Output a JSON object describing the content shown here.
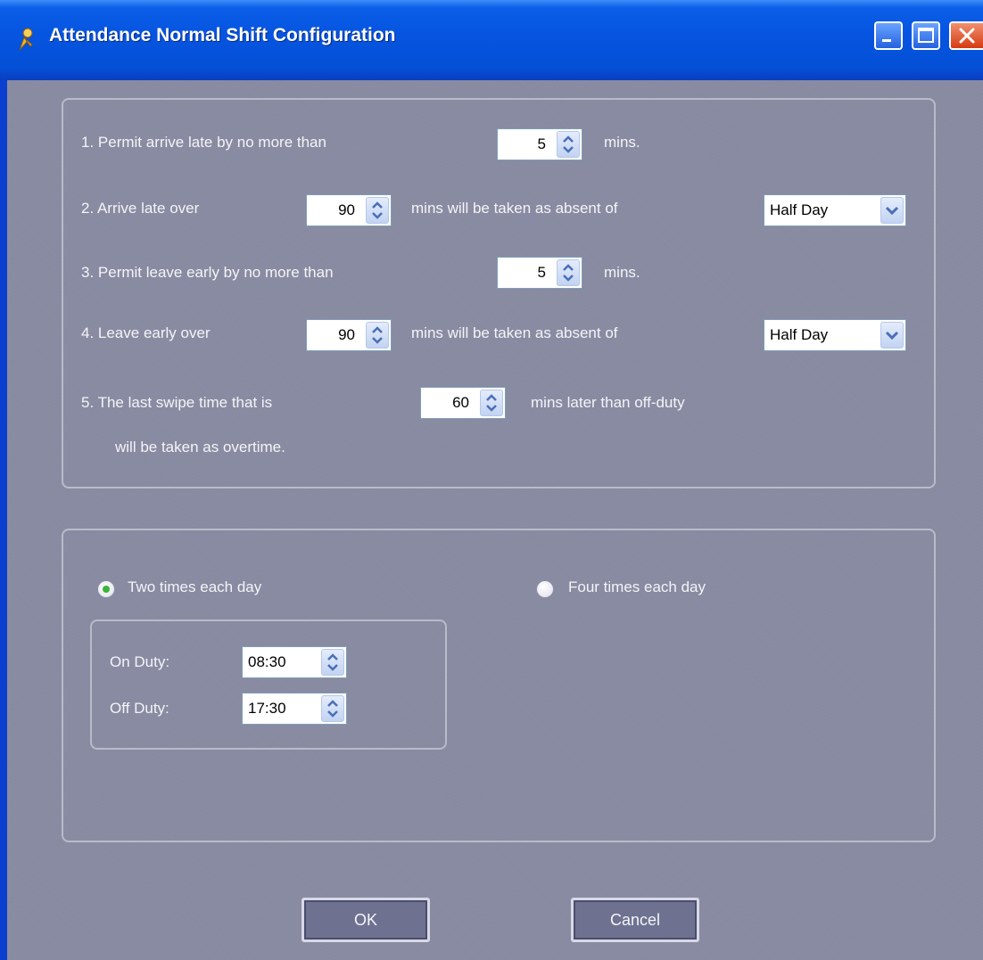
{
  "window": {
    "title": "Attendance Normal Shift Configuration",
    "icon": "attendance-app-icon",
    "controls": [
      "minimize-icon",
      "maximize-icon",
      "close-icon"
    ]
  },
  "rules": {
    "r1": {
      "label": "1. Permit arrive late by no more than",
      "value": "5",
      "unit": "mins."
    },
    "r2": {
      "label": "2. Arrive late over",
      "value": "90",
      "suffix": "mins will be taken as absent of",
      "select": "Half Day"
    },
    "r3": {
      "label": "3. Permit leave early by no more than",
      "value": "5",
      "unit": "mins."
    },
    "r4": {
      "label": "4. Leave early over",
      "value": "90",
      "suffix": "mins will be taken as absent of",
      "select": "Half Day"
    },
    "r5": {
      "label": "5. The last swipe time that is",
      "value": "60",
      "suffix": "mins later than off-duty",
      "line2": "will be taken as overtime."
    }
  },
  "schedule": {
    "option_two": {
      "label": "Two times each day",
      "selected": true
    },
    "option_four": {
      "label": "Four times each day",
      "selected": false
    },
    "on_duty": {
      "label": "On Duty:",
      "value": "08:30"
    },
    "off_duty": {
      "label": "Off Duty:",
      "value": "17:30"
    }
  },
  "buttons": {
    "ok": "OK",
    "cancel": "Cancel"
  },
  "colors": {
    "titlebar": "#0654e0",
    "client": "#878aa0",
    "radio_selected": "#3cb43c"
  }
}
